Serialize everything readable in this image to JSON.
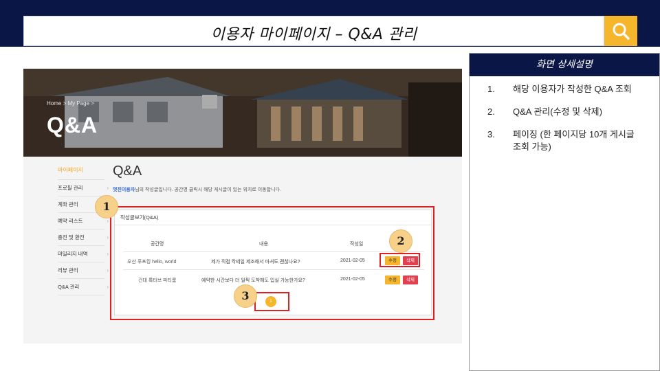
{
  "header": {
    "title": "이용자 마이페이지 – Q&A 관리",
    "search_icon": "search-icon",
    "accent": "#f5b62c",
    "navy": "#0a1646"
  },
  "screenshot": {
    "breadcrumb": "Home > My Page >",
    "hero_title": "Q&A",
    "sidebar": {
      "heading": "마이페이지",
      "items": [
        "프로필 관리",
        "계좌 관리",
        "예약 리스트",
        "충전 및 환전",
        "마일리지 내역",
        "리뷰 관리",
        "Q&A 관리"
      ]
    },
    "page_title": "Q&A",
    "desc_user": "멋진이용자",
    "desc_text": "님의 작성글입니다. 공간명 클릭시 해당 게시글이 있는 위치로 이동합니다.",
    "panel_title": "작성글보기(Q&A)",
    "columns": [
      "공간명",
      "내용",
      "작성일"
    ],
    "rows": [
      {
        "space": "오산 푸프킹 hello, world",
        "content": "제가 직접 칵테일 제조해서 마셔도 괜찮나요?",
        "date": "2021-02-05",
        "edit": "수정",
        "delete": "삭제"
      },
      {
        "space": "건대 록타브 파티룸",
        "content": "예약한 시간보다 더 일찍 도착해도 입실 가능한가요?",
        "date": "2021-02-05",
        "edit": "수정",
        "delete": "삭제"
      }
    ],
    "page_number": "1"
  },
  "markers": [
    "1",
    "2",
    "3"
  ],
  "detail_panel": {
    "title": "화면 상세설명",
    "items": [
      {
        "num": "1.",
        "text": "해당 이용자가 작성한 Q&A 조회"
      },
      {
        "num": "2.",
        "text": "Q&A 관리(수정 및 삭제)"
      },
      {
        "num": "3.",
        "text": "페이징 (한 페이지당 10개 게시글 조회 가능)"
      }
    ]
  }
}
